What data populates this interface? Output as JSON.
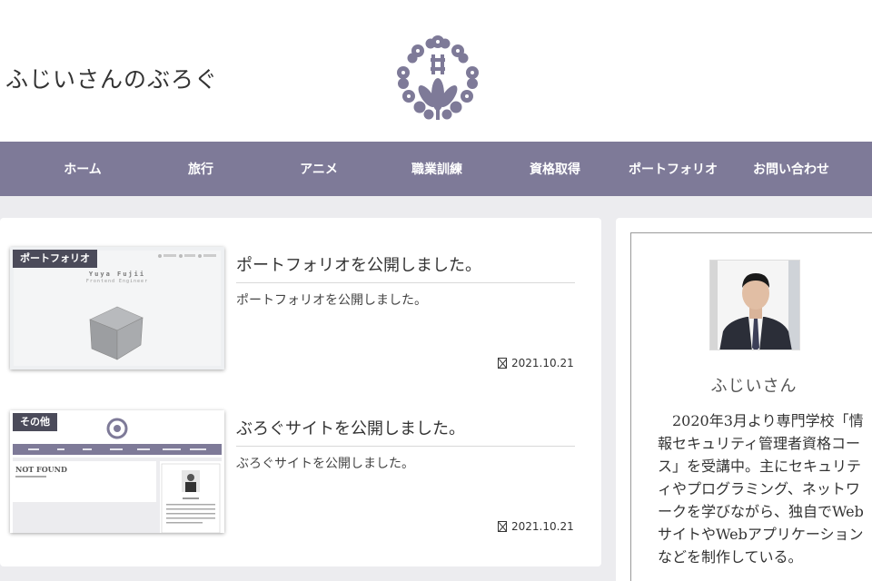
{
  "header": {
    "site_title": "ふじいさんのぶろぐ",
    "logo_icon": "family-crest-icon",
    "brand_color": "#7e7a98"
  },
  "nav": {
    "items": [
      {
        "label": "ホーム"
      },
      {
        "label": "旅行"
      },
      {
        "label": "アニメ"
      },
      {
        "label": "職業訓練"
      },
      {
        "label": "資格取得"
      },
      {
        "label": "ポートフォリオ"
      },
      {
        "label": "お問い合わせ"
      }
    ]
  },
  "entries": [
    {
      "category": "ポートフォリオ",
      "title": "ポートフォリオを公開しました。",
      "snippet": "ポートフォリオを公開しました。",
      "date": "2021.10.21",
      "thumb_name": "Yuya Fujii",
      "thumb_sub": "Frontend Engineer"
    },
    {
      "category": "その他",
      "title": "ぶろぐサイトを公開しました。",
      "snippet": "ぶろぐサイトを公開しました。",
      "date": "2021.10.21",
      "thumb_notfound": "NOT FOUND"
    }
  ],
  "sidebar": {
    "author_name": "ふじいさん",
    "bio": "　2020年3月より専門学校「情報セキュリティ管理者資格コース」を受講中。主にセキュリティやプログラミング、ネットワークを学びながら、独自でWebサイトやWebアプリケーションなどを制作している。"
  }
}
